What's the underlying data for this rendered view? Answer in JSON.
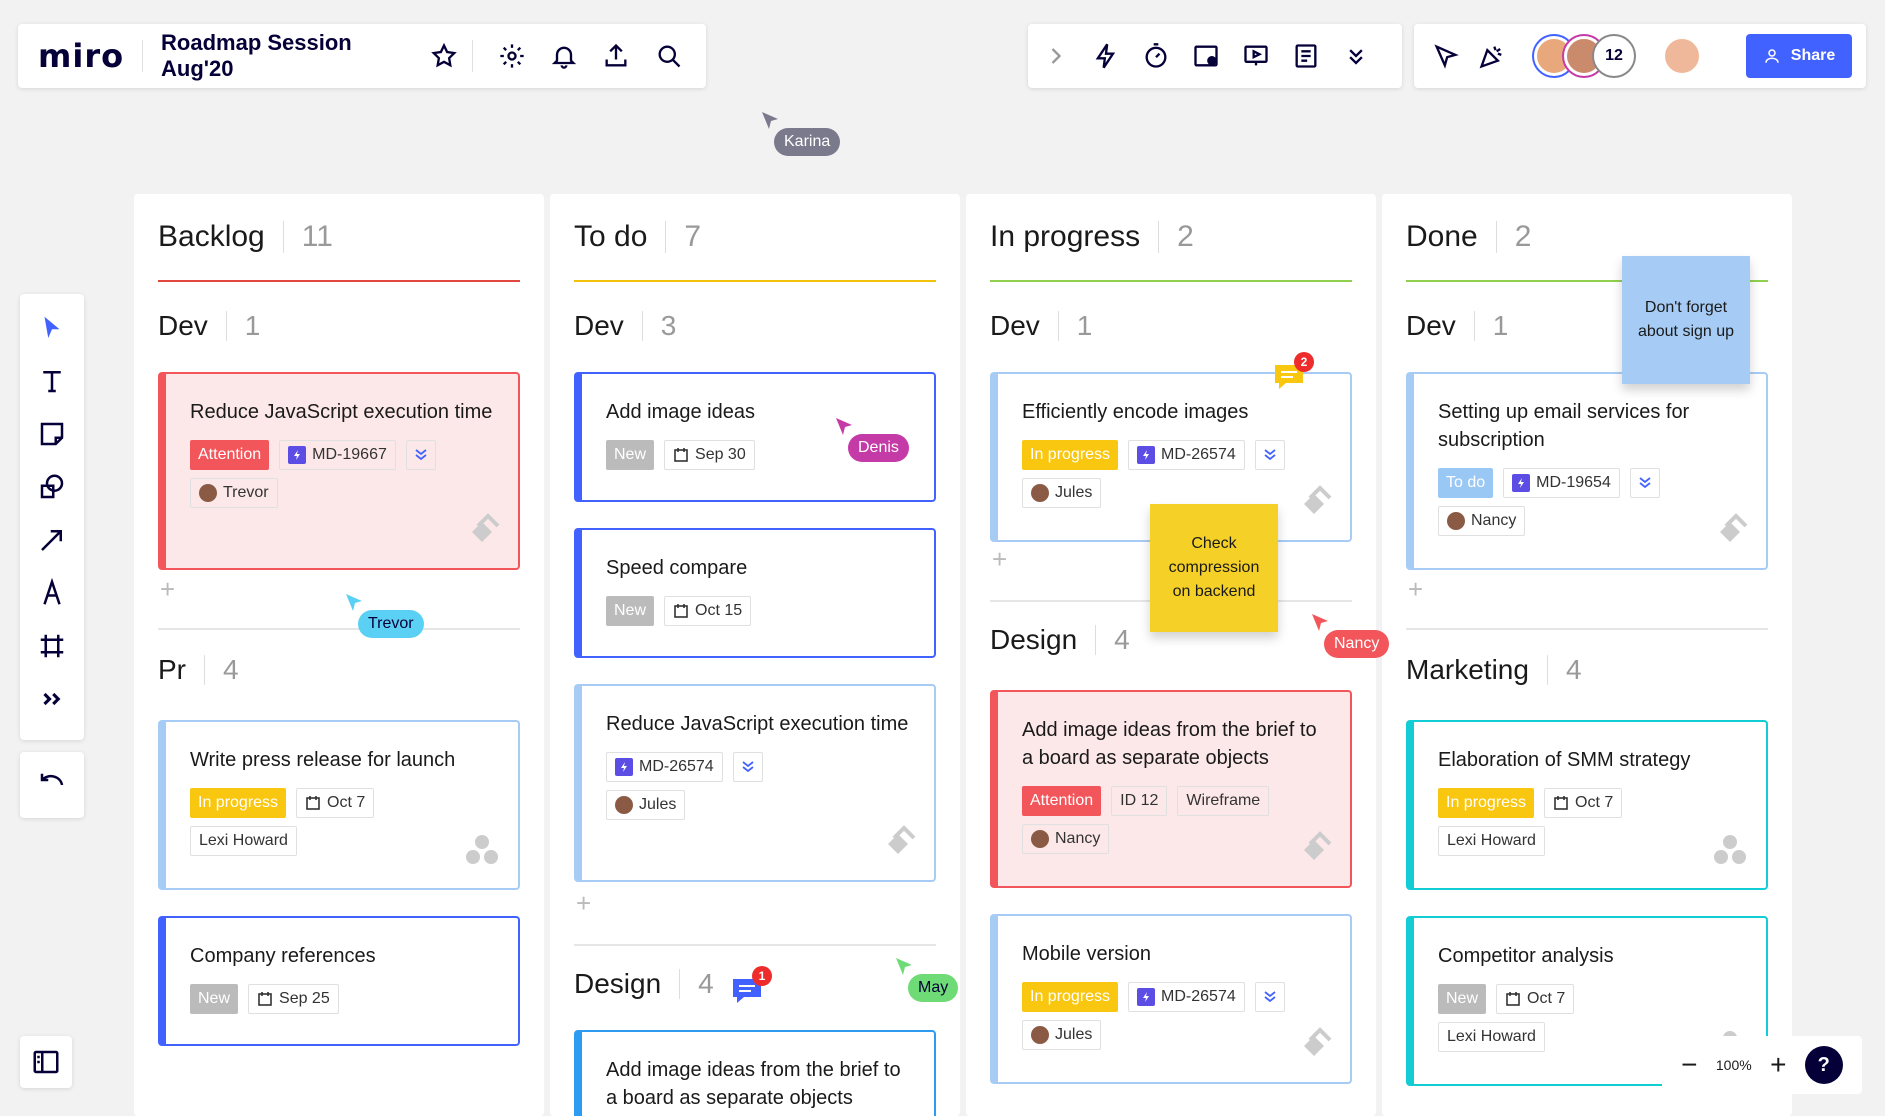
{
  "app": {
    "logo": "miro",
    "board_title": "Roadmap Session Aug'20"
  },
  "topbar": {
    "left_icons": [
      "star-icon",
      "gear-icon",
      "bell-icon",
      "upload-icon",
      "search-icon"
    ],
    "mid_icons": [
      "chevron-right-icon",
      "lightning-icon",
      "timer-icon",
      "screen-share-icon",
      "presentation-icon",
      "notes-icon",
      "chevrons-down-icon"
    ],
    "right_icons": [
      "cursor-select-icon",
      "celebrate-icon"
    ],
    "collaborator_count": "12",
    "share_label": "Share"
  },
  "left_toolbar": {
    "tools": [
      "select-icon",
      "text-icon",
      "sticky-note-icon",
      "shapes-icon",
      "arrow-icon",
      "pen-icon",
      "frame-icon",
      "more-tools-icon"
    ],
    "undo": "undo-icon",
    "frames": "frames-panel-icon"
  },
  "zoom": {
    "level": "100%",
    "minus": "−",
    "plus": "+",
    "help": "?"
  },
  "colors": {
    "backlog": "#e0473f",
    "todo": "#f2c20a",
    "inprogress": "#8fd14f",
    "done": "#8fd14f",
    "attention": "#f2555a",
    "inprogress_tag": "#fac710",
    "todo_tag": "#9ac8f5",
    "new_tag": "#bbbbbb",
    "accent": "#4262ff"
  },
  "columns": [
    {
      "title": "Backlog",
      "count": "11",
      "groups": [
        {
          "title": "Dev",
          "count": "1",
          "cards": [
            {
              "title": "Reduce JavaScript execution time",
              "tags": [
                {
                  "kind": "status",
                  "label": "Attention"
                },
                {
                  "kind": "jira",
                  "label": "MD-19667"
                },
                {
                  "kind": "priority"
                }
              ],
              "tags2": [
                {
                  "kind": "person",
                  "label": "Trevor"
                }
              ]
            }
          ]
        },
        {
          "title": "Pr",
          "count": "4",
          "cards": [
            {
              "title": "Write press release for launch",
              "tags": [
                {
                  "kind": "status",
                  "label": "In progress"
                },
                {
                  "kind": "date",
                  "label": "Oct 7"
                }
              ],
              "tags2": [
                {
                  "kind": "text",
                  "label": "Lexi Howard"
                }
              ]
            },
            {
              "title": "Company references",
              "tags": [
                {
                  "kind": "status",
                  "label": "New"
                },
                {
                  "kind": "date",
                  "label": "Sep 25"
                }
              ]
            }
          ]
        }
      ]
    },
    {
      "title": "To do",
      "count": "7",
      "groups": [
        {
          "title": "Dev",
          "count": "3",
          "cards": [
            {
              "title": "Add image ideas",
              "tags": [
                {
                  "kind": "status",
                  "label": "New"
                },
                {
                  "kind": "date",
                  "label": "Sep 30"
                }
              ]
            },
            {
              "title": "Speed compare",
              "tags": [
                {
                  "kind": "status",
                  "label": "New"
                },
                {
                  "kind": "date",
                  "label": "Oct 15"
                }
              ]
            },
            {
              "title": "Reduce JavaScript execution time",
              "tags": [
                {
                  "kind": "jira",
                  "label": "MD-26574"
                },
                {
                  "kind": "priority"
                }
              ],
              "tags2": [
                {
                  "kind": "person",
                  "label": "Jules"
                }
              ]
            }
          ]
        },
        {
          "title": "Design",
          "count": "4",
          "cards": [
            {
              "title": "Add image ideas from the brief to a board as separate objects"
            }
          ]
        }
      ]
    },
    {
      "title": "In progress",
      "count": "2",
      "groups": [
        {
          "title": "Dev",
          "count": "1",
          "cards": [
            {
              "title": "Efficiently encode images",
              "tags": [
                {
                  "kind": "status",
                  "label": "In progress"
                },
                {
                  "kind": "jira",
                  "label": "MD-26574"
                },
                {
                  "kind": "priority"
                }
              ],
              "tags2": [
                {
                  "kind": "person",
                  "label": "Jules"
                }
              ]
            }
          ]
        },
        {
          "title": "Design",
          "count": "4",
          "cards": [
            {
              "title": "Add image ideas from the brief to a board as separate objects",
              "tags": [
                {
                  "kind": "status",
                  "label": "Attention"
                },
                {
                  "kind": "text",
                  "label": "ID 12"
                },
                {
                  "kind": "text",
                  "label": "Wireframe"
                }
              ],
              "tags2": [
                {
                  "kind": "person",
                  "label": "Nancy"
                }
              ]
            },
            {
              "title": "Mobile version",
              "tags": [
                {
                  "kind": "status",
                  "label": "In progress"
                },
                {
                  "kind": "jira",
                  "label": "MD-26574"
                },
                {
                  "kind": "priority"
                }
              ],
              "tags2": [
                {
                  "kind": "person",
                  "label": "Jules"
                }
              ]
            }
          ]
        }
      ]
    },
    {
      "title": "Done",
      "count": "2",
      "groups": [
        {
          "title": "Dev",
          "count": "1",
          "cards": [
            {
              "title": "Setting up email services for subscription",
              "tags": [
                {
                  "kind": "status",
                  "label": "To do"
                },
                {
                  "kind": "jira",
                  "label": "MD-19654"
                },
                {
                  "kind": "priority"
                }
              ],
              "tags2": [
                {
                  "kind": "person",
                  "label": "Nancy"
                }
              ]
            }
          ]
        },
        {
          "title": "Marketing",
          "count": "4",
          "cards": [
            {
              "title": "Elaboration of SMM strategy",
              "tags": [
                {
                  "kind": "status",
                  "label": "In progress"
                },
                {
                  "kind": "date",
                  "label": "Oct 7"
                }
              ],
              "tags2": [
                {
                  "kind": "text",
                  "label": "Lexi Howard"
                }
              ]
            },
            {
              "title": "Competitor analysis",
              "tags": [
                {
                  "kind": "status",
                  "label": "New"
                },
                {
                  "kind": "date",
                  "label": "Oct 7"
                }
              ],
              "tags2": [
                {
                  "kind": "text",
                  "label": "Lexi Howard"
                }
              ]
            }
          ]
        }
      ]
    }
  ],
  "stickies": [
    {
      "text": "Don't forget about sign up",
      "color": "#a6ccf5"
    },
    {
      "text": "Check compression on backend",
      "color": "#f5d128"
    }
  ],
  "cursors": [
    {
      "name": "Karina",
      "color": "#7a7a8c"
    },
    {
      "name": "Trevor",
      "color": "#5bd0f5"
    },
    {
      "name": "Denis",
      "color": "#c43aa6"
    },
    {
      "name": "Nancy",
      "color": "#f2555a"
    },
    {
      "name": "May",
      "color": "#6fdb76"
    }
  ],
  "comments": [
    {
      "badge": "2"
    },
    {
      "badge": "1"
    }
  ]
}
